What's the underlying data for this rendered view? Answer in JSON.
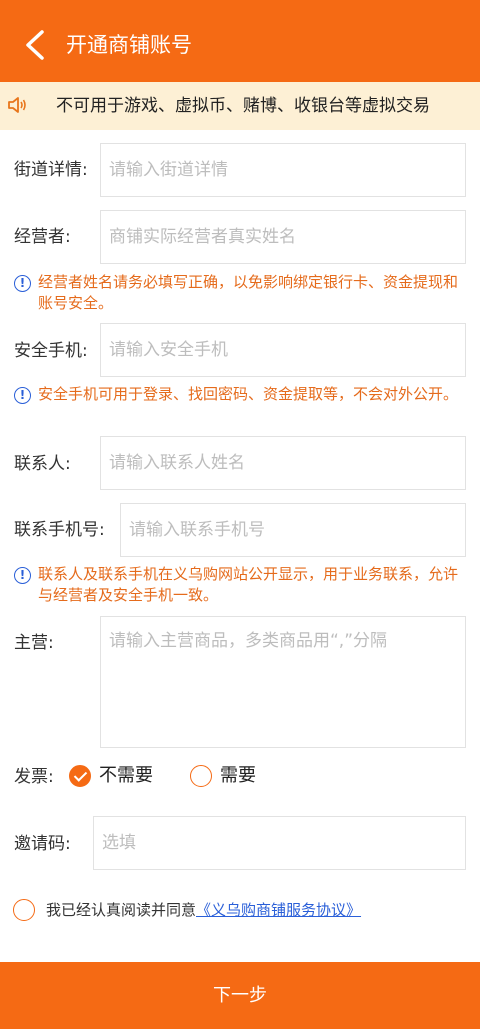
{
  "header": {
    "title": "开通商铺账号"
  },
  "notice": {
    "text": "不可用于游戏、虚拟币、赌博、收银台等虚拟交易"
  },
  "fields": {
    "street": {
      "label": "街道详情:",
      "placeholder": "请输入街道详情"
    },
    "operator": {
      "label": "经营者:",
      "placeholder": "商铺实际经营者真实姓名"
    },
    "operator_tip": "经营者姓名请务必填写正确，以免影响绑定银行卡、资金提现和账号安全。",
    "security_phone": {
      "label": "安全手机:",
      "placeholder": "请输入安全手机"
    },
    "security_phone_tip": "安全手机可用于登录、找回密码、资金提取等，不会对外公开。",
    "contact": {
      "label": "联系人:",
      "placeholder": "请输入联系人姓名"
    },
    "contact_phone": {
      "label": "联系手机号:",
      "placeholder": "请输入联系手机号"
    },
    "contact_tip": "联系人及联系手机在义乌购网站公开显示，用于业务联系，允许与经营者及安全手机一致。",
    "main_business": {
      "label": "主营:",
      "placeholder": "请输入主营商品，多类商品用“,”分隔"
    },
    "invoice": {
      "label": "发票:",
      "options": [
        "不需要",
        "需要"
      ],
      "selected": "不需要"
    },
    "invite_code": {
      "label": "邀请码:",
      "placeholder": "选填"
    }
  },
  "agreement": {
    "text": "我已经认真阅读并同意",
    "link": "《义乌购商铺服务协议》",
    "checked": false
  },
  "actions": {
    "next_label": "下一步"
  },
  "colors": {
    "accent": "#f56a14",
    "notice_bg": "#fdf0d5",
    "tip_text": "#e56b1c",
    "info_icon": "#2a5fd8"
  }
}
